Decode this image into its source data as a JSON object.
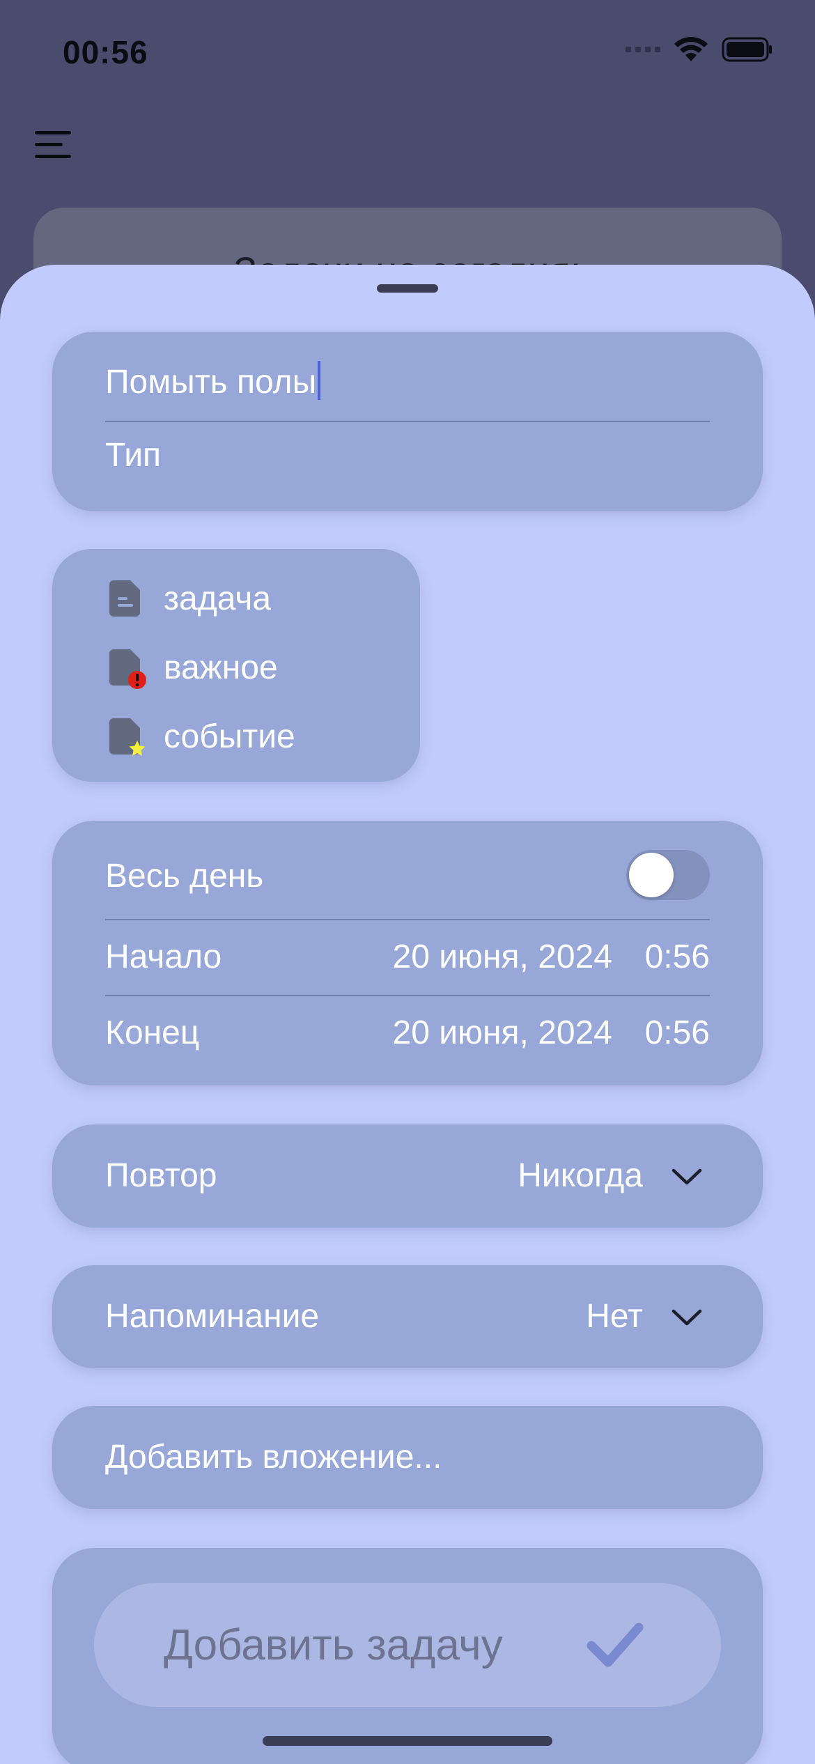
{
  "status_bar": {
    "time": "00:56"
  },
  "background": {
    "card_title": "Задачи на сегодня:"
  },
  "form": {
    "title_value": "Помыть полы",
    "type_label": "Тип",
    "types": [
      {
        "label": "задача",
        "icon": "document-icon"
      },
      {
        "label": "важное",
        "icon": "document-important-icon"
      },
      {
        "label": "событие",
        "icon": "document-event-icon"
      }
    ],
    "all_day": {
      "label": "Весь день",
      "enabled": false
    },
    "start": {
      "label": "Начало",
      "date": "20 июня, 2024",
      "time": "0:56"
    },
    "end": {
      "label": "Конец",
      "date": "20 июня, 2024",
      "time": "0:56"
    },
    "repeat": {
      "label": "Повтор",
      "value": "Никогда"
    },
    "reminder": {
      "label": "Напоминание",
      "value": "Нет"
    },
    "attachment": {
      "label": "Добавить вложение..."
    },
    "submit": {
      "label": "Добавить задачу"
    }
  },
  "colors": {
    "sheet": "#c1cbfd",
    "card": "#96a7d8",
    "background": "#4a4b6d",
    "important_badge": "#e0211a",
    "event_star": "#f3ef3e"
  }
}
